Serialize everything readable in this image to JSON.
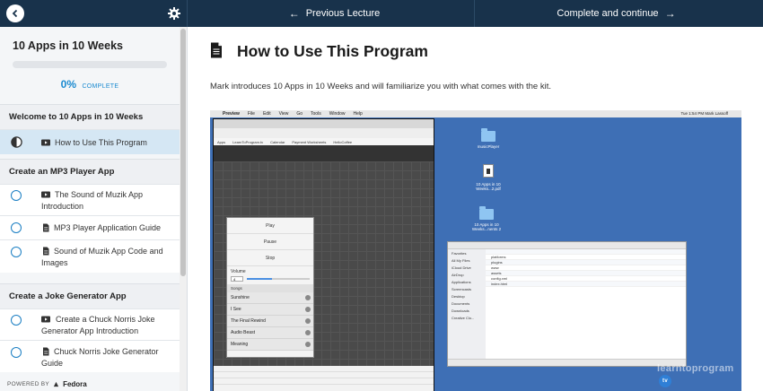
{
  "topbar": {
    "prev_label": "Previous Lecture",
    "next_label": "Complete and continue",
    "back_icon": "chevron-left-icon",
    "settings_icon": "gear-icon"
  },
  "sidebar": {
    "course_title": "10 Apps in 10 Weeks",
    "progress": {
      "percent": "0%",
      "word": "COMPLETE",
      "fraction": 0
    },
    "sections": [
      {
        "title": "Welcome to 10 Apps in 10 Weeks",
        "lectures": [
          {
            "label": "How to Use This Program",
            "type": "video",
            "status": "in-progress",
            "active": true
          }
        ]
      },
      {
        "title": "Create an MP3 Player App",
        "lectures": [
          {
            "label": "The Sound of Muzik App Introduction",
            "type": "video",
            "status": "incomplete"
          },
          {
            "label": "MP3 Player Application Guide",
            "type": "document",
            "status": "incomplete"
          },
          {
            "label": "Sound of Muzik App Code and Images",
            "type": "document",
            "status": "incomplete"
          }
        ]
      },
      {
        "title": "Create a Joke Generator App",
        "lectures": [
          {
            "label": "Create a Chuck Norris Joke Generator App Introduction",
            "type": "video",
            "status": "incomplete"
          },
          {
            "label": "Chuck Norris Joke Generator Guide",
            "type": "document",
            "status": "incomplete"
          }
        ]
      }
    ],
    "powered_by": "POWERED BY",
    "powered_brand": "Fedora"
  },
  "main": {
    "title": "How to Use This Program",
    "description": "Mark introduces 10 Apps in 10 Weeks and will familiarize you with what comes with the kit.",
    "video": {
      "menubar_items": [
        "Preview",
        "File",
        "Edit",
        "View",
        "Go",
        "Tools",
        "Window",
        "Help"
      ],
      "menubar_right": "Tue 1:54 PM   Mark Lassoff",
      "bookmarks": [
        "Apps",
        "LearnToProgram.tv",
        "Calendar",
        "Payment Worksheets",
        "HelloCoffee"
      ],
      "phone_buttons": [
        "Play",
        "Pause",
        "Stop"
      ],
      "volume_label": "Volume",
      "volume_value": "4",
      "songs_header": "Songs",
      "songs": [
        "Sunshine",
        "I See",
        "The Final Rewind",
        "Audio Beast",
        "Meaning"
      ],
      "desktop_items": [
        "musicPlayer",
        "10 Apps in 10 Weeks...2.pdf",
        "10 Apps in 10 Weeks...nents 2"
      ],
      "finder_sidebar": [
        "Favorites",
        "All My Files",
        "iCloud Drive",
        "AirDrop",
        "Applications",
        "Screencasts",
        "Desktop",
        "Documents",
        "Downloads",
        "Creative Clo..."
      ],
      "finder_rows": [
        "platforms",
        "plugins",
        "www",
        "assets",
        "config.xml",
        "index.html"
      ],
      "watermark": "learntoprogram",
      "watermark_badge": "tv"
    }
  },
  "colors": {
    "topbar": "#18324b",
    "accent": "#1a8ad0",
    "active_row": "#d5e7f4"
  }
}
